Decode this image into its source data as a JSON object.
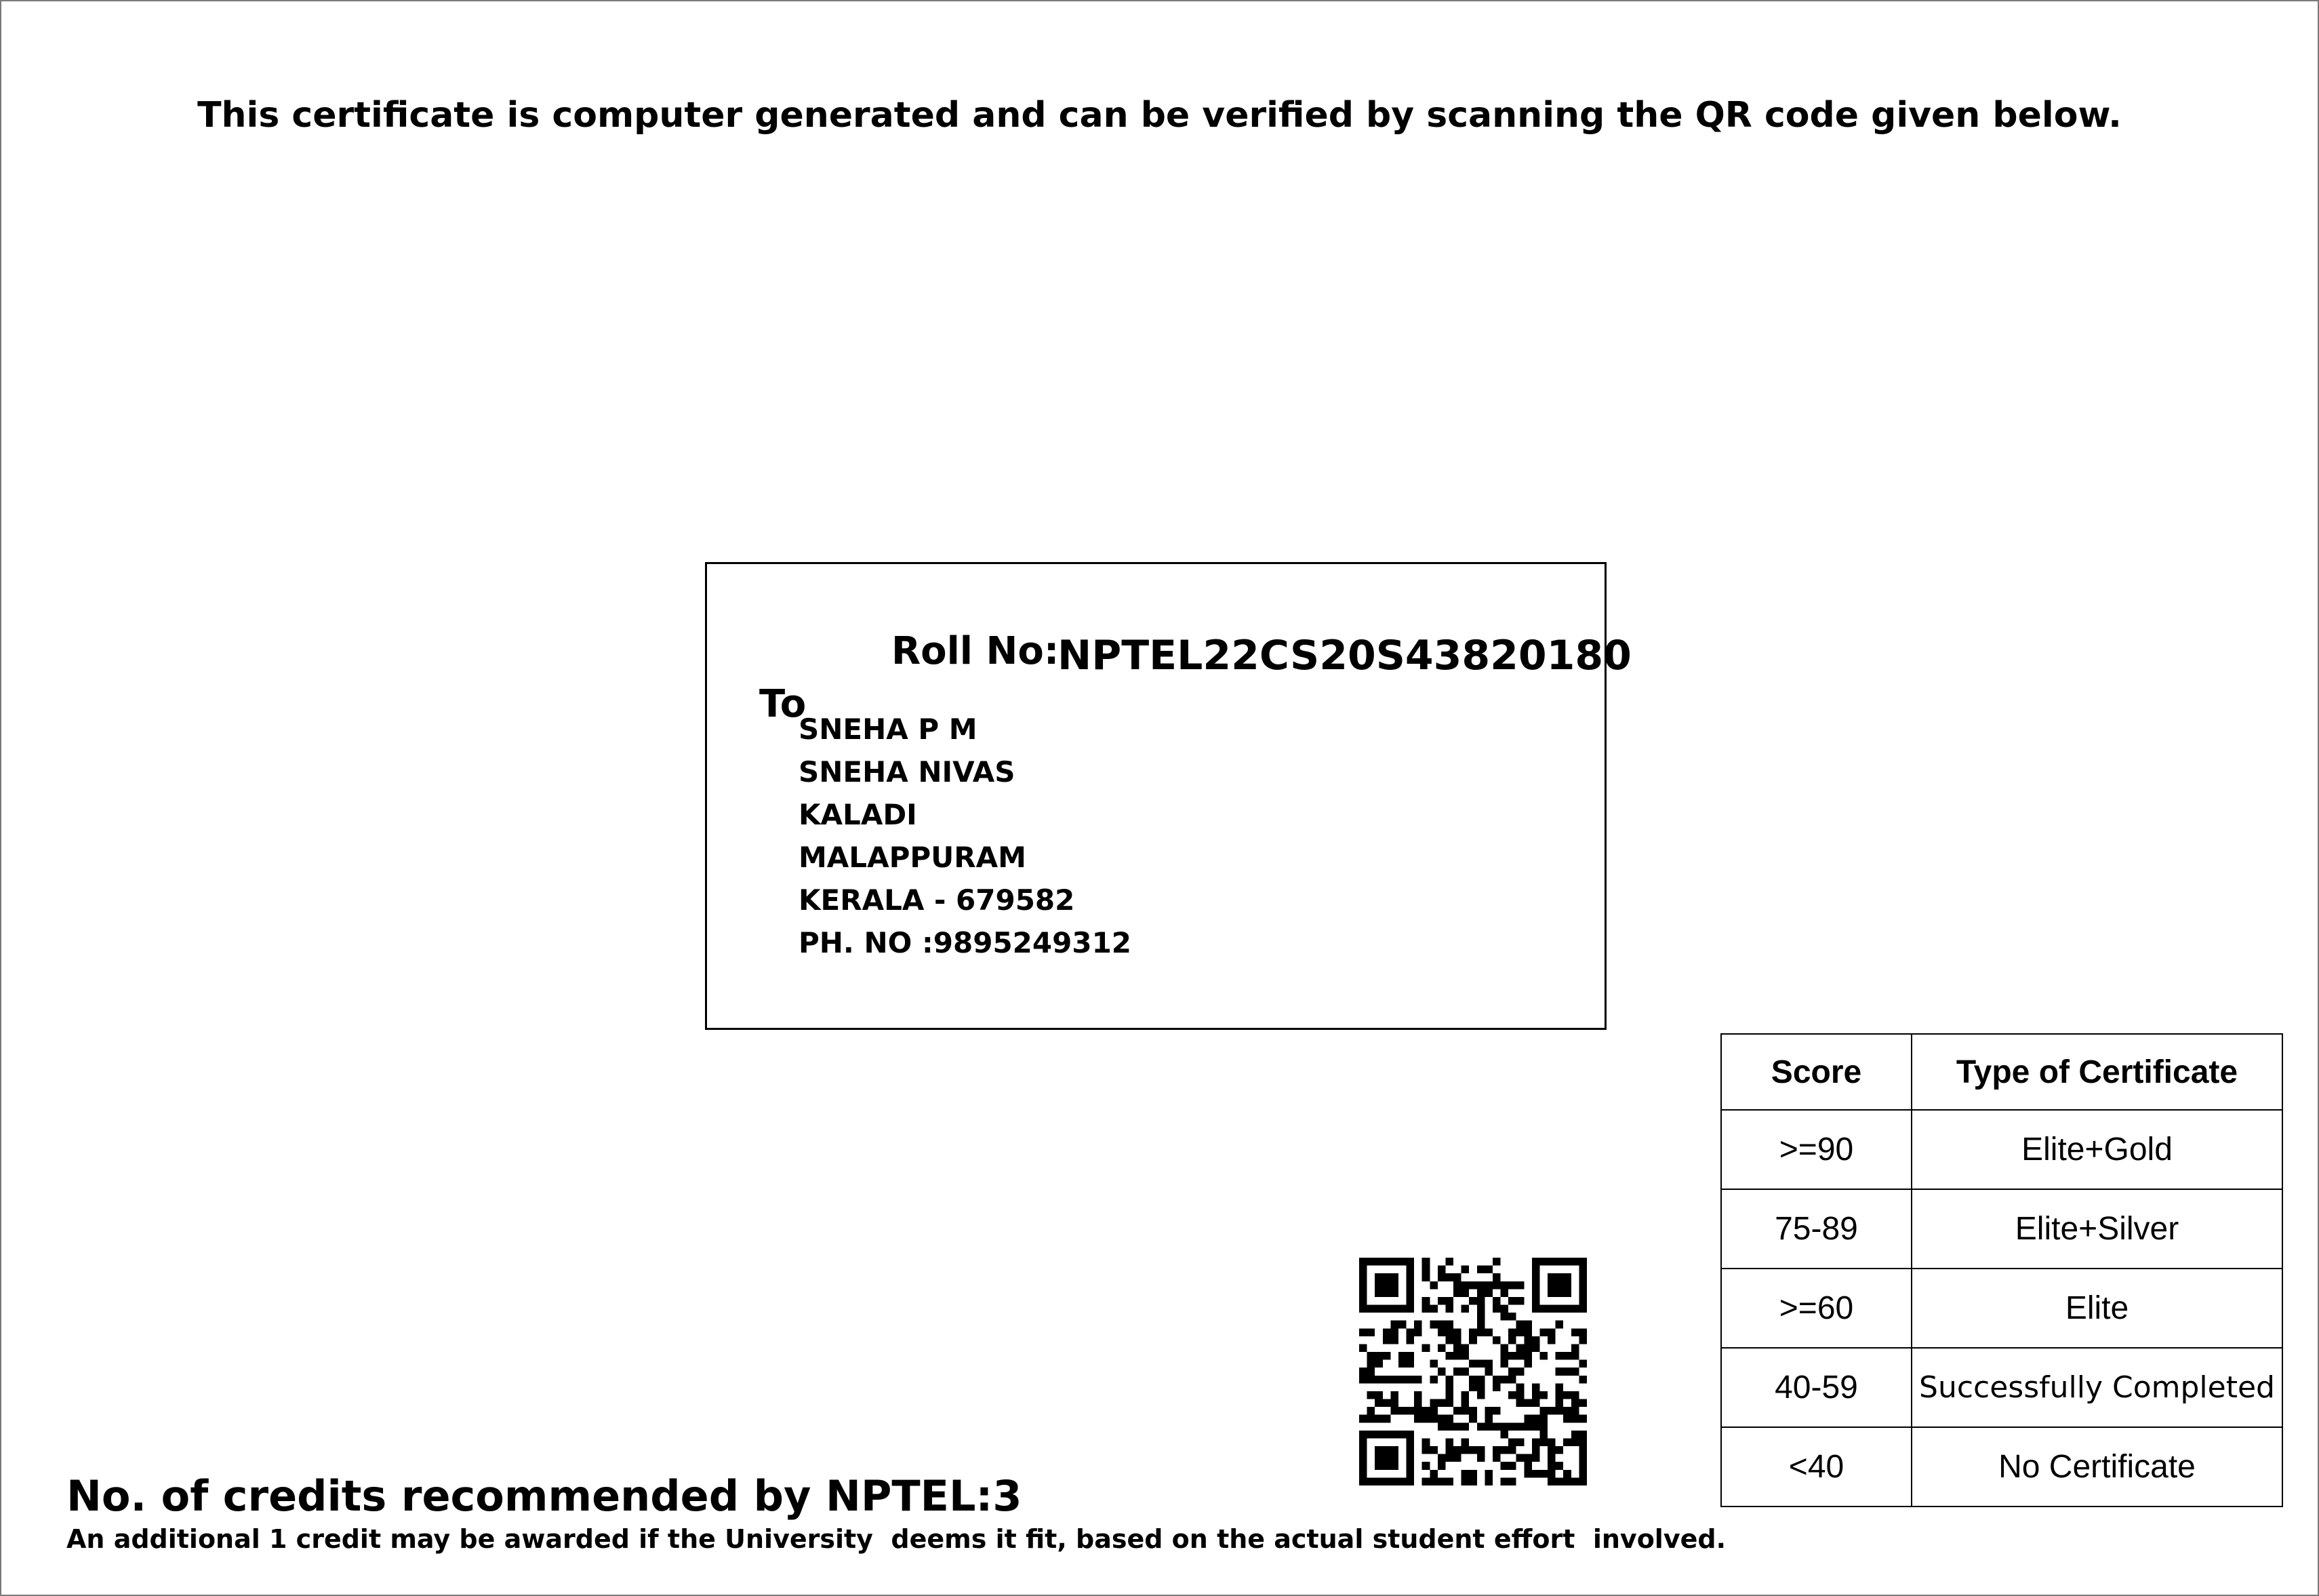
{
  "notice": "This certificate is computer generated and can be verified by scanning the QR code given below.",
  "recipient": {
    "roll_label": "Roll No:",
    "roll_number": "NPTEL22CS20S43820180",
    "to_label": "To",
    "address_lines": [
      "SNEHA P M",
      "SNEHA NIVAS",
      "KALADI",
      "MALAPPURAM",
      "KERALA - 679582",
      "PH. NO :9895249312"
    ]
  },
  "qr_code": {
    "icon": "qr-code-icon"
  },
  "score_table": {
    "headers": {
      "score": "Score",
      "type": "Type of Certificate"
    },
    "rows": [
      {
        "score": ">=90",
        "type": "Elite+Gold"
      },
      {
        "score": "75-89",
        "type": "Elite+Silver"
      },
      {
        "score": ">=60",
        "type": "Elite"
      },
      {
        "score": "40-59",
        "type": "Successfully Completed"
      },
      {
        "score": "<40",
        "type": "No Certificate"
      }
    ]
  },
  "credits": {
    "heading": "No. of credits recommended by NPTEL:3",
    "note": "An additional 1 credit may be awarded if the University  deems it fit, based on the actual student effort  involved."
  }
}
